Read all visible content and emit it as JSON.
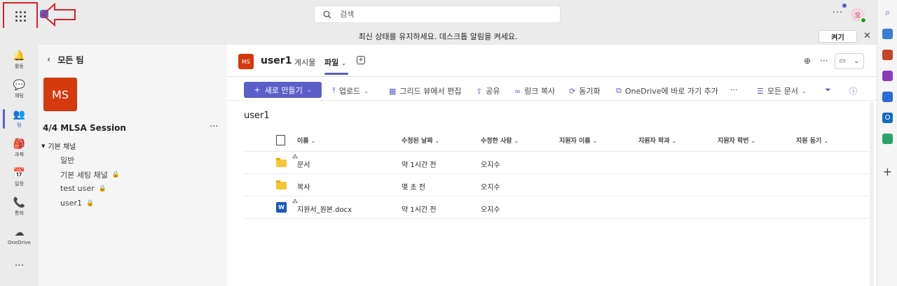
{
  "topbar": {
    "search_placeholder": "검색",
    "more": "···",
    "avatar_initial": "오"
  },
  "banner": {
    "message": "최신 상태를 유지하세요. 데스크톱 알림을 켜세요.",
    "button": "켜기",
    "close": "✕"
  },
  "rail": {
    "items": [
      {
        "label": "활동",
        "icon": "bell-icon",
        "glyph": "🔔"
      },
      {
        "label": "채팅",
        "icon": "chat-icon",
        "glyph": "💬"
      },
      {
        "label": "팀",
        "icon": "teams-icon",
        "glyph": "👥"
      },
      {
        "label": "과제",
        "icon": "assignments-icon",
        "glyph": "🎒"
      },
      {
        "label": "일정",
        "icon": "calendar-icon",
        "glyph": "📅"
      },
      {
        "label": "통화",
        "icon": "phone-icon",
        "glyph": "📞"
      },
      {
        "label": "OneDrive",
        "icon": "onedrive-icon",
        "glyph": "☁"
      }
    ],
    "active_index": 2,
    "more": "···"
  },
  "teamlist": {
    "back_label": "모든 팀",
    "team_avatar": "MS",
    "team_name": "4/4 MLSA Session",
    "team_more": "···",
    "section": "기본 채널",
    "channels": [
      {
        "name": "일반",
        "private": false
      },
      {
        "name": "기본 세팅 채널",
        "private": true
      },
      {
        "name": "test user",
        "private": true
      },
      {
        "name": "user1",
        "private": true
      }
    ]
  },
  "channel": {
    "avatar": "MS",
    "title": "user1",
    "tabs": [
      "게시물",
      "파일"
    ],
    "active_tab": "파일",
    "add_tab": "+",
    "more": "···"
  },
  "toolbar": {
    "new_button": "새로 만들기",
    "upload": "업로드",
    "grid_edit": "그리드 뷰에서 편집",
    "share": "공유",
    "copy_link": "링크 복사",
    "sync": "동기화",
    "onedrive_shortcut": "OneDrive에 바로 가기 추가",
    "more": "···",
    "all_docs": "모든 문서"
  },
  "folder_title": "user1",
  "table": {
    "columns": [
      "이름",
      "수정된 날짜",
      "수정한 사람",
      "지원자 이름",
      "지원자 학과",
      "지원자 학번",
      "지원 동기"
    ],
    "rows": [
      {
        "name": "문서",
        "type": "folder",
        "modified": "약 1시간 전",
        "modified_by": "오지수",
        "new": true
      },
      {
        "name": "복사",
        "type": "folder",
        "modified": "몇 초 전",
        "modified_by": "오지수",
        "new": false
      },
      {
        "name": "지원서_원본.docx",
        "type": "word",
        "modified": "약 1시간 전",
        "modified_by": "오지수",
        "new": true
      }
    ]
  },
  "colors": {
    "accent": "#5b5fc7",
    "team_avatar": "#d4380d",
    "annotation": "#d6212a"
  }
}
